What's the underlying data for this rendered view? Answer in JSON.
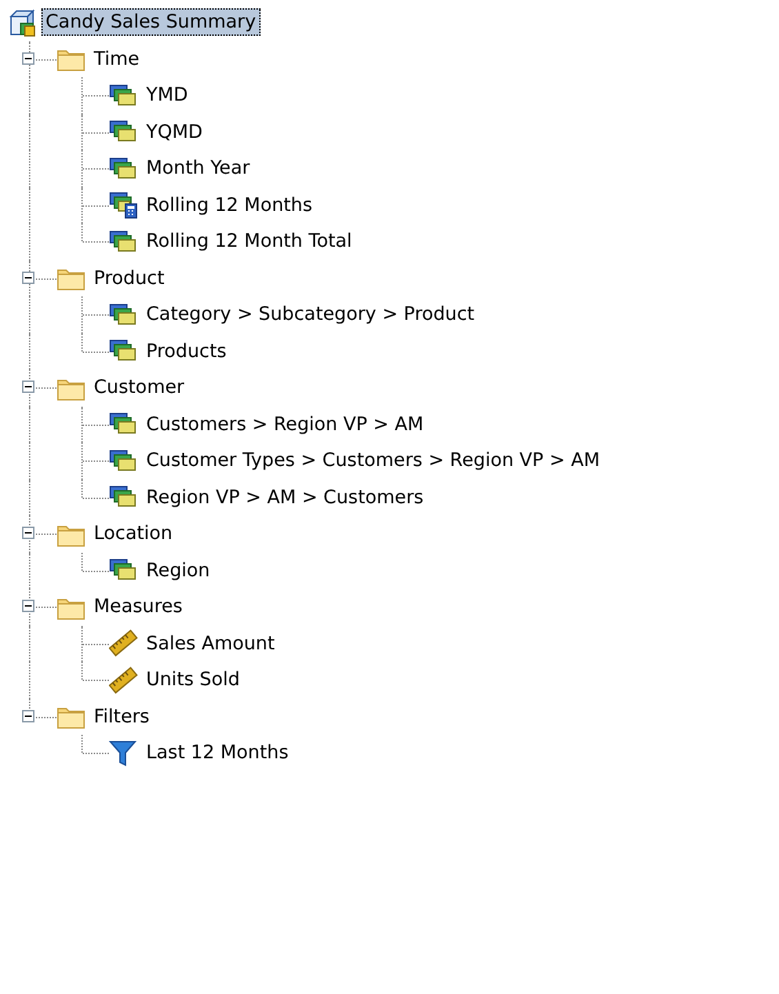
{
  "tree": {
    "label": "Candy Sales Summary",
    "selected": true,
    "children": [
      {
        "label": "Time",
        "expanded": true,
        "children": [
          {
            "label": "YMD",
            "kind": "hierarchy"
          },
          {
            "label": "YQMD",
            "kind": "hierarchy"
          },
          {
            "label": "Month Year",
            "kind": "hierarchy"
          },
          {
            "label": "Rolling 12 Months",
            "kind": "calculated"
          },
          {
            "label": "Rolling 12 Month Total",
            "kind": "hierarchy"
          }
        ]
      },
      {
        "label": "Product",
        "expanded": true,
        "children": [
          {
            "label": "Category > Subcategory > Product",
            "kind": "hierarchy"
          },
          {
            "label": "Products",
            "kind": "hierarchy"
          }
        ]
      },
      {
        "label": "Customer",
        "expanded": true,
        "children": [
          {
            "label": "Customers > Region VP > AM",
            "kind": "hierarchy"
          },
          {
            "label": "Customer Types > Customers > Region VP > AM",
            "kind": "hierarchy"
          },
          {
            "label": "Region VP > AM > Customers",
            "kind": "hierarchy"
          }
        ]
      },
      {
        "label": "Location",
        "expanded": true,
        "children": [
          {
            "label": "Region",
            "kind": "hierarchy"
          }
        ]
      },
      {
        "label": "Measures",
        "expanded": true,
        "children": [
          {
            "label": "Sales Amount",
            "kind": "measure"
          },
          {
            "label": "Units Sold",
            "kind": "measure"
          }
        ]
      },
      {
        "label": "Filters",
        "expanded": true,
        "children": [
          {
            "label": "Last 12 Months",
            "kind": "filter"
          }
        ]
      }
    ]
  }
}
